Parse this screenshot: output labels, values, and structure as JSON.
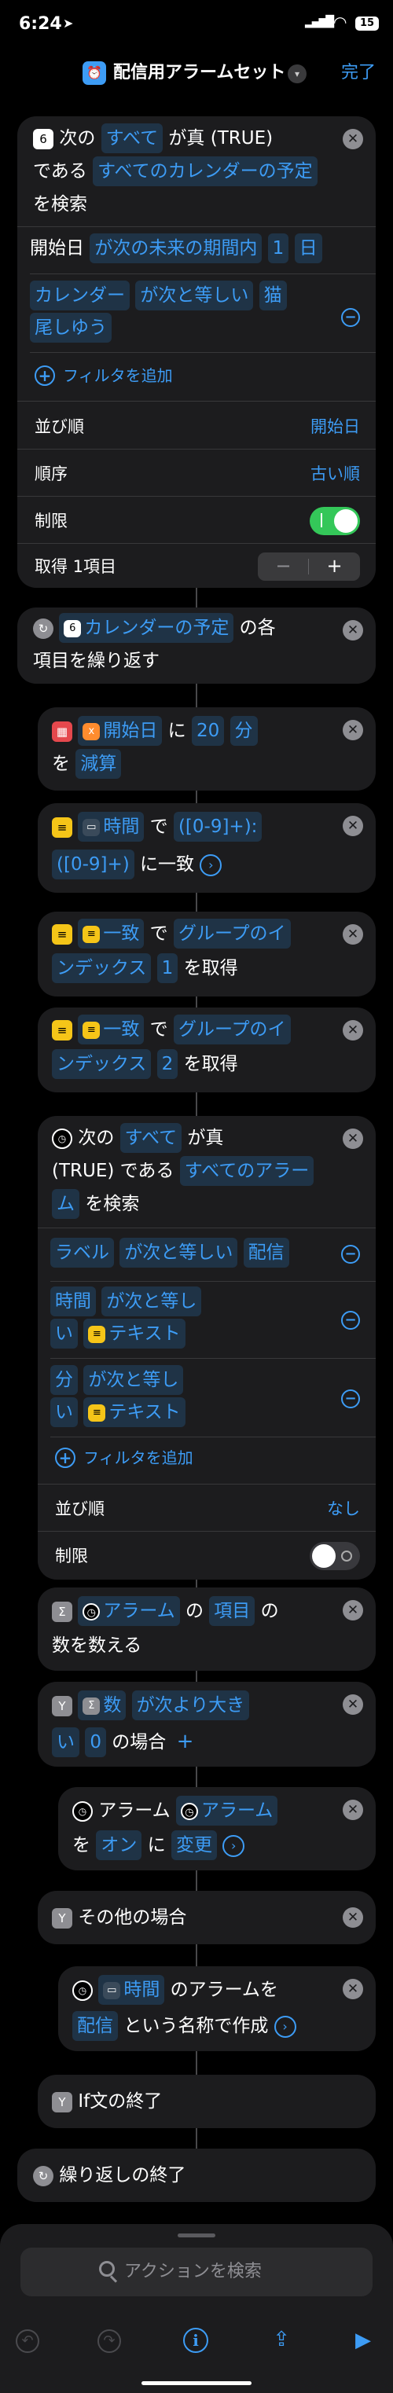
{
  "status_bar": {
    "time": "6:24",
    "battery": "15"
  },
  "nav": {
    "title": "配信用アラームセット",
    "done": "完了"
  },
  "find_events": {
    "w1": "次の",
    "w2": "すべて",
    "w3": "が真 (TRUE)",
    "w4": "である",
    "w5": "すべてのカレンダーの予定",
    "w6": "を検索",
    "filter1": {
      "a": "開始日",
      "b": "が次の未来の期間内",
      "c": "1",
      "d": "日"
    },
    "filter2": {
      "a": "カレンダー",
      "b": "が次と等しい",
      "c": "猫",
      "d": "尾しゆう"
    },
    "add_filter": "フィルタを追加",
    "sort_label": "並び順",
    "sort_value": "開始日",
    "order_label": "順序",
    "order_value": "古い順",
    "limit_label": "制限",
    "get_label": "取得 1項目"
  },
  "repeat": {
    "token": "カレンダーの予定",
    "w1": "の各",
    "w2": "項目を繰り返す"
  },
  "adjust": {
    "token": "開始日",
    "w1": "に",
    "n": "20",
    "unit": "分",
    "w2": "を",
    "op": "減算"
  },
  "match": {
    "token": "時間",
    "w1": "で",
    "p1": "([0-9]+):",
    "p2": "([0-9]+)",
    "w2": "に一致"
  },
  "group1": {
    "token": "一致",
    "w1": "で",
    "t1": "グループのイ",
    "t2": "ンデックス",
    "n": "1",
    "w2": "を取得"
  },
  "group2": {
    "token": "一致",
    "w1": "で",
    "t1": "グループのイ",
    "t2": "ンデックス",
    "n": "2",
    "w2": "を取得"
  },
  "find_alarms": {
    "w1": "次の",
    "w2": "すべて",
    "w3": "が真",
    "w4": "(TRUE) である",
    "w5": "すべてのアラー",
    "w6": "ム",
    "w7": "を検索",
    "f1": {
      "a": "ラベル",
      "b": "が次と等しい",
      "c": "配信"
    },
    "f2": {
      "a": "時間",
      "b": "が次と等し",
      "c": "い",
      "d": "テキスト"
    },
    "f3": {
      "a": "分",
      "b": "が次と等し",
      "c": "い",
      "d": "テキスト"
    },
    "add_filter": "フィルタを追加",
    "sort_label": "並び順",
    "sort_value": "なし",
    "limit_label": "制限"
  },
  "count": {
    "token": "アラーム",
    "w1": "の",
    "t2": "項目",
    "w2": "の",
    "w3": "数を数える"
  },
  "if_block": {
    "token": "数",
    "t2": "が次より大き",
    "t3": "い",
    "n": "0",
    "w1": "の場合"
  },
  "toggle_alarm": {
    "w1": "アラーム",
    "token": "アラーム",
    "w2": "を",
    "state": "オン",
    "w3": "に",
    "op": "変更"
  },
  "otherwise": {
    "label": "その他の場合"
  },
  "create_alarm": {
    "token": "時間",
    "w1": "のアラームを",
    "label": "配信",
    "w2": "という名称で作成"
  },
  "end_if": {
    "label": "If文の終了"
  },
  "end_repeat": {
    "label": "繰り返しの終了"
  },
  "search": {
    "placeholder": "アクションを検索"
  }
}
